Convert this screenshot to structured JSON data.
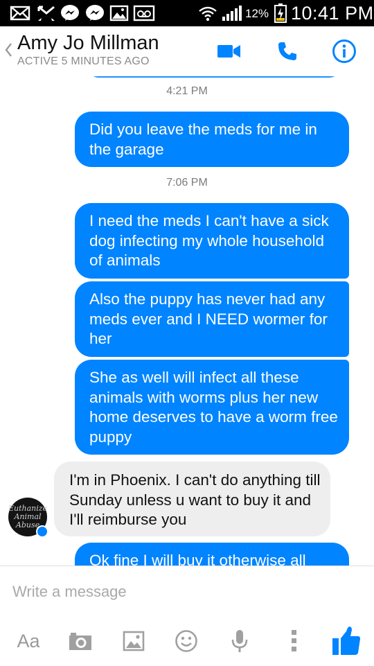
{
  "status_bar": {
    "time": "10:41 PM",
    "battery_percent": "12%",
    "left_icons": [
      "envelope-icon",
      "missed-call-icon",
      "messenger-icon",
      "messenger-icon",
      "gallery-icon",
      "voicemail-icon"
    ],
    "right_icons": [
      "wifi-icon",
      "signal-icon",
      "battery-charging-icon"
    ]
  },
  "header": {
    "contact_name": "Amy Jo Millman",
    "status": "ACTIVE 5 MINUTES AGO",
    "actions": [
      "video-call-icon",
      "phone-icon",
      "info-icon"
    ],
    "accent_color": "#0084ff"
  },
  "conversation": {
    "timestamps": [
      "4:21 PM",
      "7:06 PM"
    ],
    "messages": [
      {
        "sender": "me",
        "text": "Did you leave the meds for me in the garage"
      },
      {
        "sender": "me",
        "text": "I need the meds I can't have a sick dog infecting my whole household of animals"
      },
      {
        "sender": "me",
        "text": "Also the puppy has never had any meds ever and I NEED wormer for her"
      },
      {
        "sender": "me",
        "text": "She as well will infect all these animals with worms plus her new home deserves to have a worm free puppy"
      },
      {
        "sender": "contact",
        "text": "I'm in Phoenix. I can't do anything till Sunday unless u want to buy it and I'll reimburse you"
      },
      {
        "sender": "me",
        "text": "Ok fine I will buy it otherwise all"
      }
    ],
    "avatar_text": "Euthanize\nAnimal\nAbuse",
    "outgoing_color": "#0084ff",
    "incoming_color": "#eeeeee"
  },
  "composer": {
    "placeholder": "Write a message",
    "tools": [
      "text-format-icon",
      "camera-icon",
      "image-icon",
      "emoji-icon",
      "microphone-icon",
      "more-icon",
      "like-thumb-icon"
    ],
    "aa_label": "Aa"
  }
}
